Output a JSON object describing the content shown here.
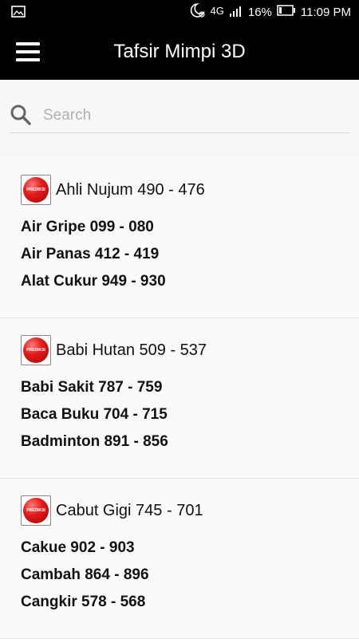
{
  "status": {
    "network": "4G",
    "battery": "16%",
    "time": "11:09 PM"
  },
  "app": {
    "title": "Tafsir Mimpi 3D"
  },
  "search": {
    "placeholder": "Search",
    "value": ""
  },
  "badge_text": "PREDIKSI",
  "groups": [
    {
      "header": "Ahli Nujum 490 - 476",
      "items": [
        "Air Gripe 099 - 080",
        "Air Panas 412 - 419",
        "Alat Cukur 949 - 930"
      ]
    },
    {
      "header": "Babi Hutan 509 - 537",
      "items": [
        "Babi Sakit 787 - 759",
        "Baca Buku 704 - 715",
        "Badminton 891 - 856"
      ]
    },
    {
      "header": "Cabut Gigi 745 - 701",
      "items": [
        "Cakue 902 - 903",
        "Cambah 864 - 896",
        "Cangkir 578 - 568"
      ]
    }
  ]
}
